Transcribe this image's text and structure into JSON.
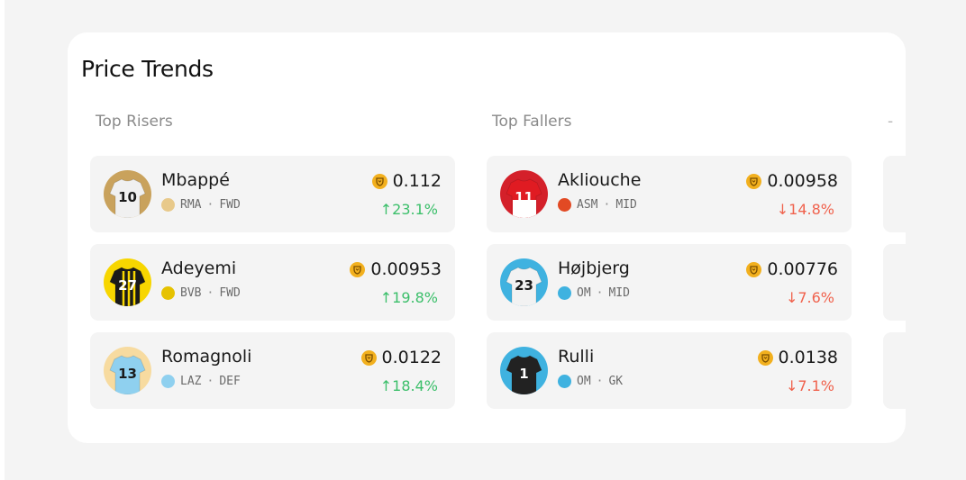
{
  "card": {
    "title": "Price Trends"
  },
  "risers": {
    "title": "Top Risers",
    "players": [
      {
        "name": "Mbappé",
        "club": "RMA",
        "position": "FWD",
        "price": "0.112",
        "change": "23.1%",
        "jersey_number": "10",
        "jersey_color": "#f0f0f0",
        "avatar_bg": "#c9a25c",
        "club_color": "#e8c98a"
      },
      {
        "name": "Adeyemi",
        "club": "BVB",
        "position": "FWD",
        "price": "0.00953",
        "change": "19.8%",
        "jersey_number": "27",
        "jersey_color": "#1a1a1a",
        "avatar_bg": "#f7d600",
        "club_color": "#e6c200"
      },
      {
        "name": "Romagnoli",
        "club": "LAZ",
        "position": "DEF",
        "price": "0.0122",
        "change": "18.4%",
        "jersey_number": "13",
        "jersey_color": "#8fd0ef",
        "avatar_bg": "#f7dba0",
        "club_color": "#8fd0ef"
      }
    ]
  },
  "fallers": {
    "title": "Top Fallers",
    "players": [
      {
        "name": "Akliouche",
        "club": "ASM",
        "position": "MID",
        "price": "0.00958",
        "change": "14.8%",
        "jersey_number": "11",
        "jersey_color": "#e01b22",
        "avatar_bg": "#d4202a",
        "club_color": "#e24a24"
      },
      {
        "name": "Højbjerg",
        "club": "OM",
        "position": "MID",
        "price": "0.00776",
        "change": "7.6%",
        "jersey_number": "23",
        "jersey_color": "#f2f2f2",
        "avatar_bg": "#3fb2e0",
        "club_color": "#3fb2e0"
      },
      {
        "name": "Rulli",
        "club": "OM",
        "position": "GK",
        "price": "0.0138",
        "change": "7.1%",
        "jersey_number": "1",
        "jersey_color": "#222222",
        "avatar_bg": "#3fb2e0",
        "club_color": "#3fb2e0"
      }
    ]
  },
  "icons": {
    "coin": "coin-icon",
    "up": "arrow-up-icon",
    "down": "arrow-down-icon"
  },
  "colors": {
    "up": "#3bbf6a",
    "down": "#f0624d",
    "coin": "#f2b01e"
  }
}
